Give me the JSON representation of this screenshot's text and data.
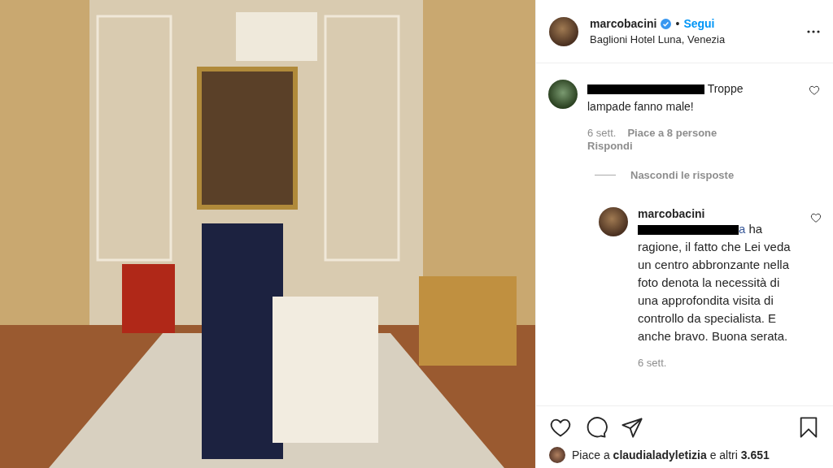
{
  "header": {
    "username": "marcobacini",
    "verified": true,
    "separator": "•",
    "follow": "Segui",
    "location": "Baglioni Hotel Luna, Venezia"
  },
  "comments": [
    {
      "redacted": true,
      "text": "Troppe lampade fanno male!",
      "time": "6 sett.",
      "likes": "Piace a 8 persone",
      "reply": "Rispondi"
    }
  ],
  "hide_replies": "Nascondi le risposte",
  "replies": [
    {
      "username": "marcobacini",
      "redacted": true,
      "mention": "a",
      "text": "ha ragione, il fatto che Lei veda un centro abbronzante nella foto denota la necessità di una approfondita visita di controllo da specialista. E anche bravo. Buona serata.",
      "time": "6 sett."
    }
  ],
  "likes": "Piace a **claudialadyletizia** e altri **3.651**"
}
